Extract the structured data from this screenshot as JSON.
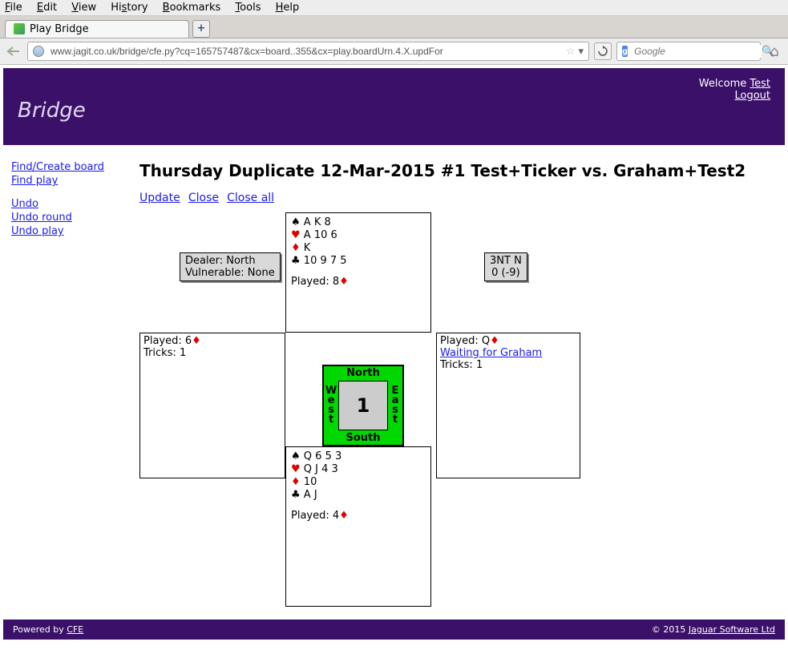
{
  "browser": {
    "menu": [
      "File",
      "Edit",
      "View",
      "History",
      "Bookmarks",
      "Tools",
      "Help"
    ],
    "tab_title": "Play Bridge",
    "url": "www.jagit.co.uk/bridge/cfe.py?cq=165757487&cx=board..355&cx=play.boardUrn.4.X.updFor",
    "search_placeholder": "Google"
  },
  "header": {
    "title": "Bridge",
    "welcome": "Welcome",
    "user": "Test",
    "logout": "Logout"
  },
  "sidebar": {
    "find_board": "Find/Create board",
    "find_play": "Find play",
    "undo": "Undo",
    "undo_round": "Undo round",
    "undo_play": "Undo play"
  },
  "main": {
    "heading": "Thursday Duplicate 12-Mar-2015 #1 Test+Ticker vs. Graham+Test2",
    "actions": {
      "update": "Update",
      "close": "Close",
      "close_all": "Close all"
    }
  },
  "board": {
    "dealer": "Dealer: North",
    "vulnerable": "Vulnerable: None",
    "contract_line1": "3NT N",
    "contract_line2": "0 (-9)",
    "compass": {
      "n": "North",
      "s": "South",
      "w": "West",
      "e": "East",
      "num": "1"
    },
    "north": {
      "spades": "A K 8",
      "hearts": "A 10 6",
      "diamonds": "K",
      "clubs": "10 9 7 5",
      "played_label": "Played: 8",
      "played_suit": "♦"
    },
    "south": {
      "spades": "Q 6 5 3",
      "hearts": "Q J 4 3",
      "diamonds": "10",
      "clubs": "A J",
      "played_label": "Played: 4",
      "played_suit": "♦"
    },
    "west": {
      "played_label": "Played: 6",
      "played_suit": "♦",
      "tricks": "Tricks: 1"
    },
    "east": {
      "played_label": "Played: Q",
      "played_suit": "♦",
      "waiting": "Waiting for Graham",
      "tricks": "Tricks: 1"
    }
  },
  "footer": {
    "powered": "Powered by ",
    "cfe": "CFE",
    "copy": "© 2015 ",
    "company": "Jaguar Software Ltd"
  }
}
